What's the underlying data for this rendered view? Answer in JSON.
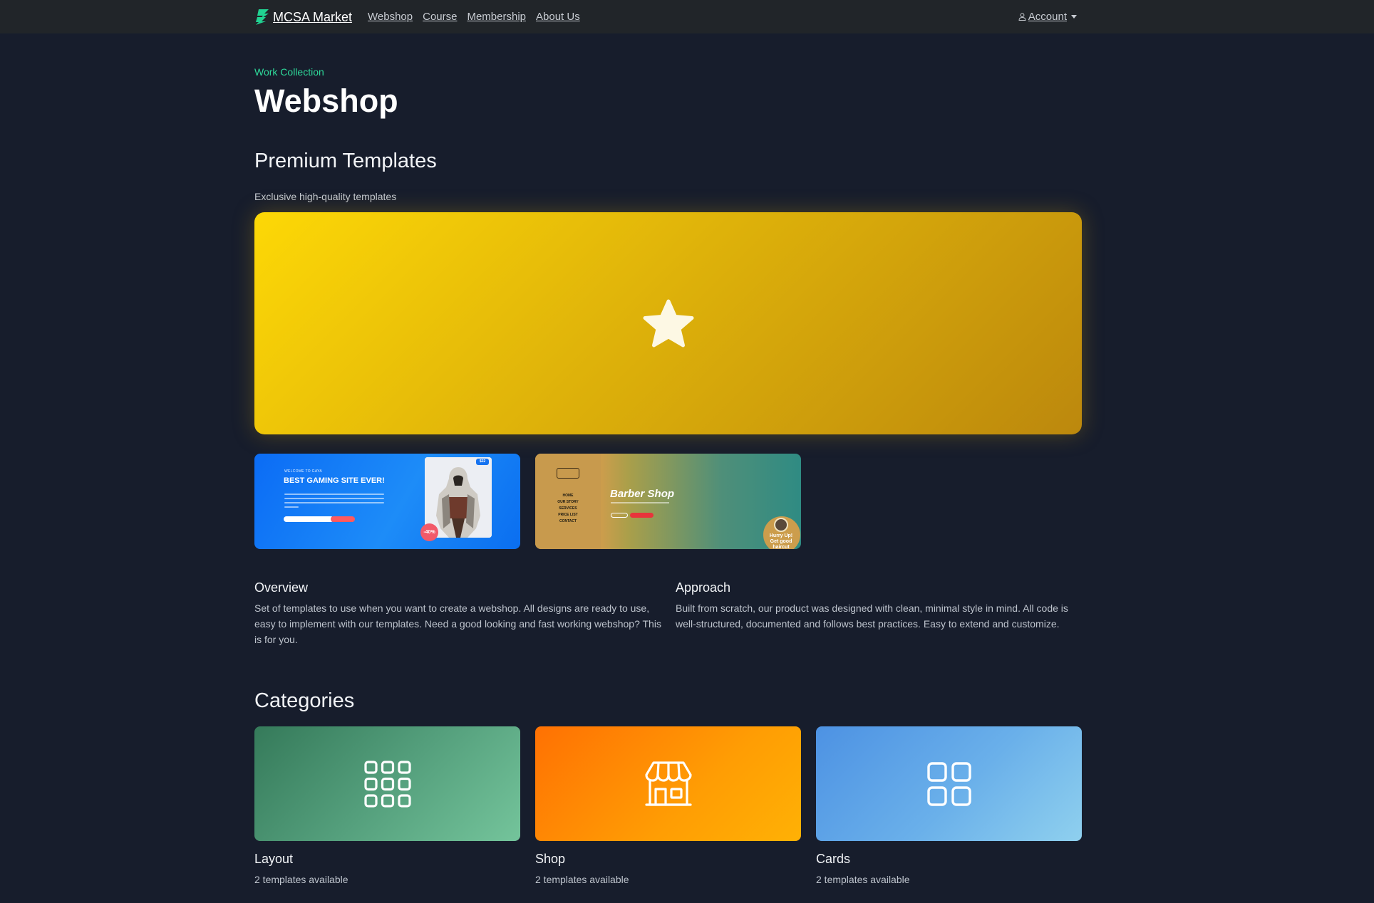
{
  "nav": {
    "brand": "MCSA Market",
    "links": [
      "Webshop",
      "Course",
      "Membership",
      "About Us"
    ],
    "account": "Account"
  },
  "header": {
    "eyebrow": "Work Collection",
    "title": "Webshop"
  },
  "premium": {
    "title": "Premium Templates",
    "subtitle": "Exclusive high-quality templates",
    "hero_icon": "star-icon"
  },
  "thumbnails": [
    {
      "name": "gaming-template",
      "welcome": "WELCOME TO GAYA",
      "headline": "BEST GAMING SITE EVER!",
      "tag": "$22",
      "discount": "-40%"
    },
    {
      "name": "barber-template",
      "menu": [
        "HOME",
        "OUR STORY",
        "SERVICES",
        "PRICE LIST",
        "CONTACT"
      ],
      "headline": "Barber Shop",
      "badge": "Hurry Up! Get good haircut"
    }
  ],
  "overview": {
    "title": "Overview",
    "text": "Set of templates to use when you want to create a webshop. All designs are ready to use, easy to implement with our templates. Need a good looking and fast working webshop? This is for you."
  },
  "approach": {
    "title": "Approach",
    "text": "Built from scratch, our product was designed with clean, minimal style in mind. All code is well-structured, documented and follows best practices. Easy to extend and customize."
  },
  "categories": {
    "title": "Categories",
    "items": [
      {
        "name": "Layout",
        "count": "2 templates available",
        "icon": "grid-icon"
      },
      {
        "name": "Shop",
        "count": "2 templates available",
        "icon": "shop-icon"
      },
      {
        "name": "Cards",
        "count": "2 templates available",
        "icon": "cards-icon"
      }
    ]
  },
  "colors": {
    "background": "#171d2c",
    "navbar": "#212529",
    "accent": "#2ed99a",
    "hero_gold": "#fdd806"
  }
}
